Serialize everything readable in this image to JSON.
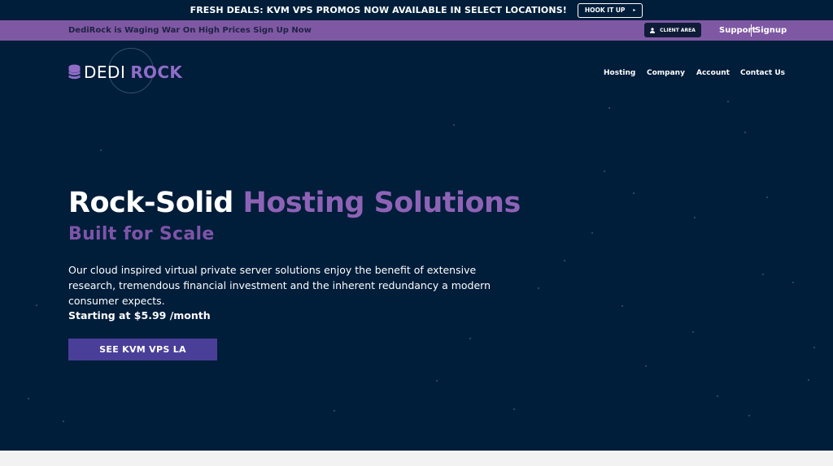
{
  "promo": {
    "text": "FRESH DEALS: KVM VPS PROMOS NOW AVAILABLE IN SELECT LOCATIONS!",
    "button_label": "HOOK IT UP",
    "caret": "▸"
  },
  "topbar": {
    "message": "DediRock is Waging War On High Prices Sign Up Now",
    "client_area_label": "CLIENT AREA",
    "support_label": "Support",
    "signup_label": "Signup"
  },
  "logo": {
    "part1": "DEDI",
    "part2": "ROCK"
  },
  "nav": {
    "items": [
      "Hosting",
      "Company",
      "Account",
      "Contact Us"
    ]
  },
  "hero": {
    "title_white": "Rock-Solid",
    "title_purple": "Hosting Solutions",
    "subtitle": "Built for Scale",
    "description": "Our cloud inspired virtual private server solutions enjoy the benefit of extensive research, tremendous financial investment and the inherent redundancy a modern consumer expects.",
    "price": "Starting at $5.99 /month",
    "cta_label": "SEE KVM VPS LA"
  },
  "colors": {
    "navy": "#001d3a",
    "purple_bar": "#7f58a3",
    "accent_purple": "#8e63b6",
    "button": "#4a3f98"
  }
}
